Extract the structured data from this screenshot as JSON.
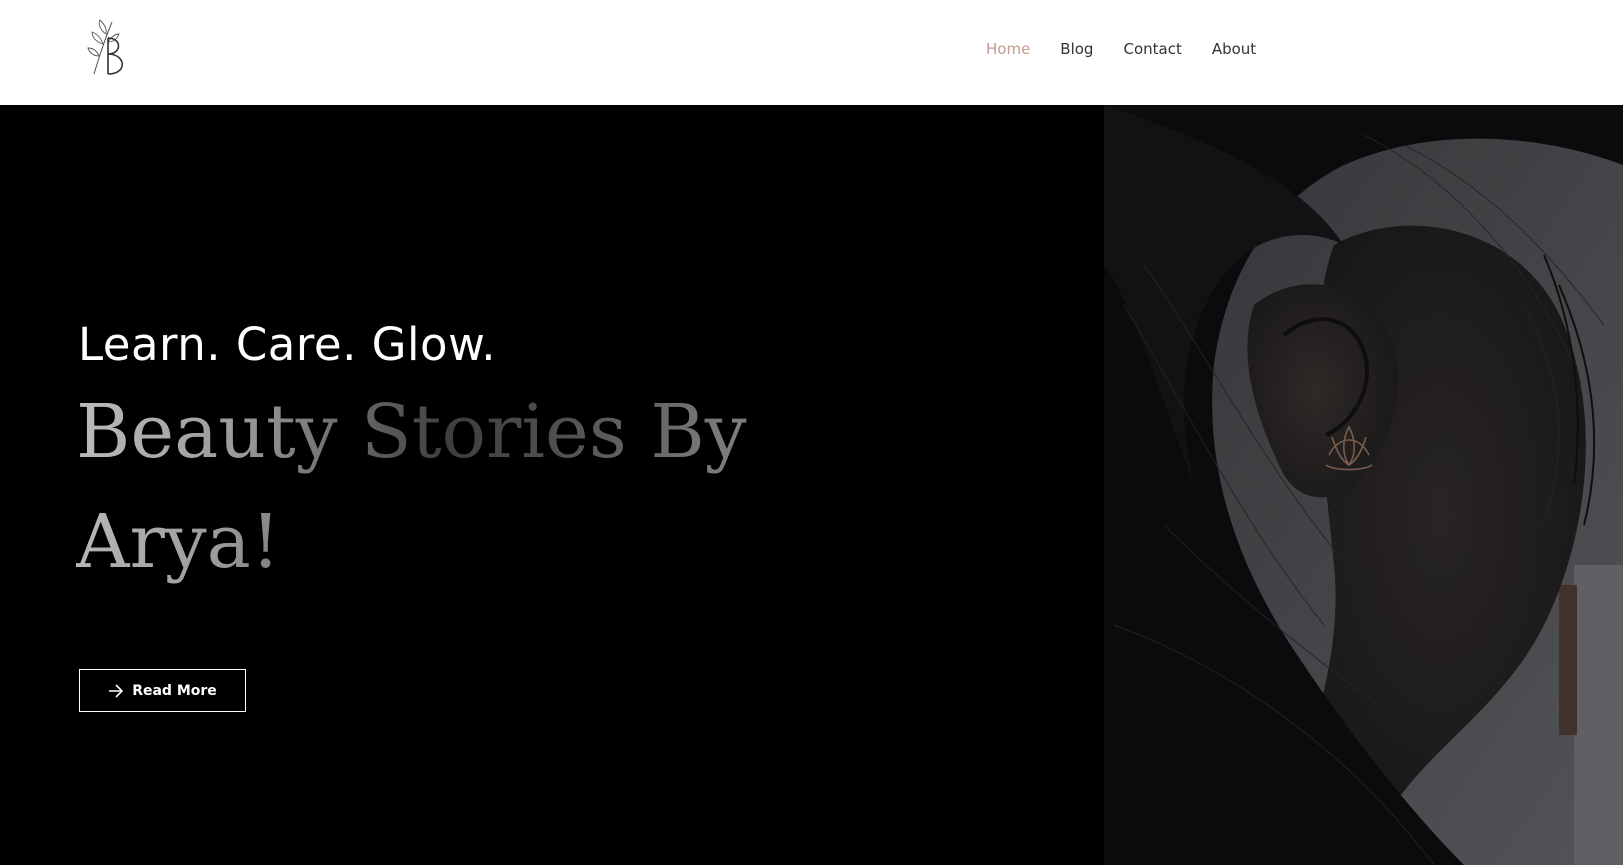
{
  "header": {
    "logo_alt": "B",
    "nav": [
      {
        "label": "Home",
        "active": true
      },
      {
        "label": "Blog",
        "active": false
      },
      {
        "label": "Contact",
        "active": false
      },
      {
        "label": "About",
        "active": false
      }
    ]
  },
  "hero": {
    "tagline": "Learn. Care. Glow.",
    "headline": "Beauty Stories By Arya!",
    "button_label": "Read More",
    "button_icon": "arrow-right-icon",
    "image": "woman-ear-lotus-earring-photo"
  },
  "colors": {
    "nav_active": "#c39a93",
    "nav_default": "#333333",
    "hero_bg": "#000000"
  }
}
